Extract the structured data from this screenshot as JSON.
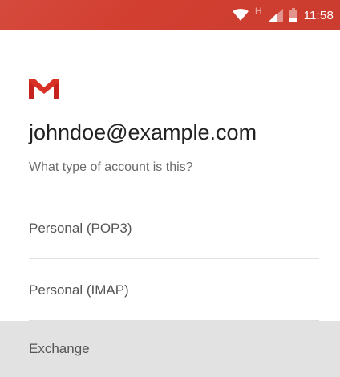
{
  "status_bar": {
    "network_indicator": "H",
    "time": "11:58",
    "icons": [
      "wifi-icon",
      "signal-icon",
      "battery-icon"
    ],
    "color": "#d23f31"
  },
  "logo": {
    "name": "gmail-logo",
    "colors": [
      "#d93025",
      "#c5221f"
    ]
  },
  "account": {
    "email": "johndoe@example.com",
    "question": "What type of account is this?"
  },
  "options": [
    {
      "label": "Personal (POP3)",
      "selected": false
    },
    {
      "label": "Personal (IMAP)",
      "selected": false
    },
    {
      "label": "Exchange",
      "selected": true
    }
  ],
  "colors": {
    "selected_row": "#e2e2e2",
    "divider": "#e0e0e0"
  }
}
